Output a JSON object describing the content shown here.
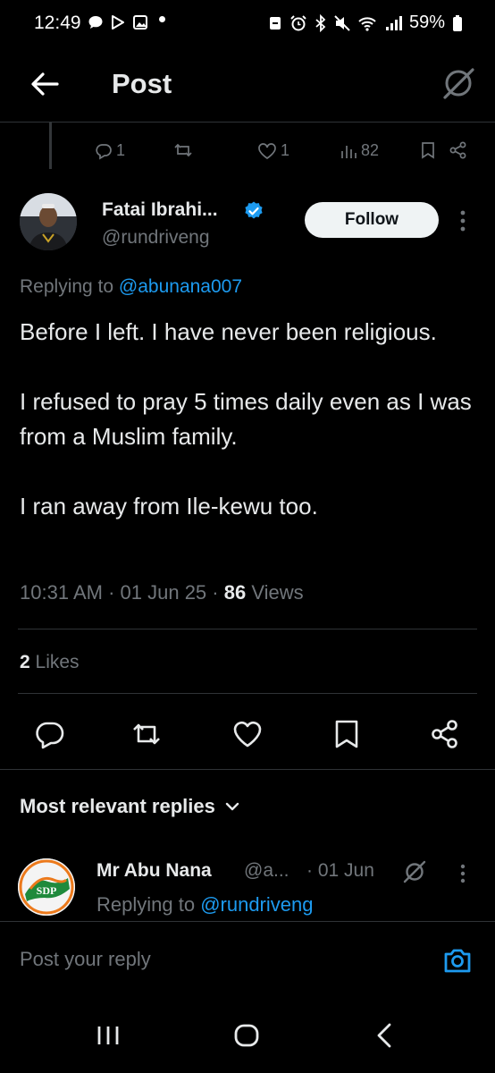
{
  "status_bar": {
    "time": "12:49",
    "battery": "59%",
    "left_icons": [
      "chat-bubble-icon",
      "play-store-icon",
      "gallery-icon",
      "dot"
    ],
    "right_icons": [
      "dnd-icon",
      "alarm-icon",
      "bluetooth-icon",
      "mute-icon",
      "wifi-icon",
      "signal-icon",
      "battery-icon"
    ]
  },
  "header": {
    "title": "Post"
  },
  "parent_actions": {
    "replies": "1",
    "reposts": "",
    "likes": "1",
    "views": "82"
  },
  "tweet": {
    "author_name": "Fatai Ibrahi...",
    "author_handle": "@rundriveng",
    "follow_label": "Follow",
    "replying_prefix": "Replying to ",
    "replying_to": "@abunana007",
    "text": "Before I left. I have never been religious.\n\nI refused to pray 5 times daily even as I was from a Muslim family.\n\nI ran away from Ile-kewu too.",
    "time": "10:31 AM",
    "date": "01 Jun 25",
    "views_count": "86",
    "views_label": "Views",
    "likes_count": "2",
    "likes_label": "Likes",
    "separator": "·"
  },
  "replies_section": {
    "label": "Most relevant replies"
  },
  "reply_preview": {
    "name": "Mr Abu Nana",
    "handle": "@a...",
    "date": "· 01 Jun",
    "replying_prefix": "Replying to ",
    "replying_to": "@rundriveng",
    "avatar_text": "SDP"
  },
  "composer": {
    "placeholder": "Post your reply"
  },
  "colors": {
    "accent": "#1d9bf0",
    "background": "#000000",
    "muted": "#71767b",
    "text": "#e7e9ea"
  }
}
